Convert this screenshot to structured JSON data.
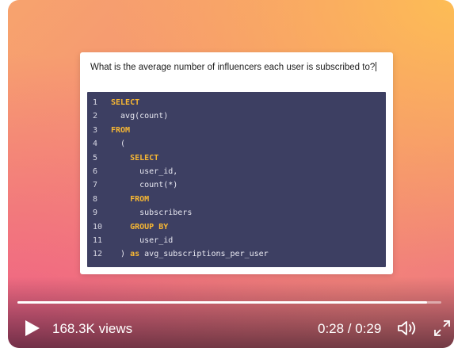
{
  "question": "What is the average number of influencers each user is subscribed to?",
  "code_lines": [
    {
      "num": "1",
      "parts": [
        {
          "t": "SELECT",
          "kw": true
        }
      ]
    },
    {
      "num": "2",
      "parts": [
        {
          "t": "  avg(count)",
          "kw": false
        }
      ]
    },
    {
      "num": "3",
      "parts": [
        {
          "t": "FROM",
          "kw": true
        }
      ]
    },
    {
      "num": "4",
      "parts": [
        {
          "t": "  (",
          "kw": false
        }
      ]
    },
    {
      "num": "5",
      "parts": [
        {
          "t": "    ",
          "kw": false
        },
        {
          "t": "SELECT",
          "kw": true
        }
      ]
    },
    {
      "num": "6",
      "parts": [
        {
          "t": "      user_id,",
          "kw": false
        }
      ]
    },
    {
      "num": "7",
      "parts": [
        {
          "t": "      count(*)",
          "kw": false
        }
      ]
    },
    {
      "num": "8",
      "parts": [
        {
          "t": "    ",
          "kw": false
        },
        {
          "t": "FROM",
          "kw": true
        }
      ]
    },
    {
      "num": "9",
      "parts": [
        {
          "t": "      subscribers",
          "kw": false
        }
      ]
    },
    {
      "num": "10",
      "parts": [
        {
          "t": "    ",
          "kw": false
        },
        {
          "t": "GROUP BY",
          "kw": true
        }
      ]
    },
    {
      "num": "11",
      "parts": [
        {
          "t": "      user_id",
          "kw": false
        }
      ]
    },
    {
      "num": "12",
      "parts": [
        {
          "t": "  ) ",
          "kw": false
        },
        {
          "t": "as",
          "kw": true
        },
        {
          "t": " avg_subscriptions_per_user",
          "kw": false
        }
      ]
    }
  ],
  "player": {
    "views": "168.3K views",
    "time": "0:28 / 0:29",
    "progress": 0.9655,
    "icons": {
      "play": "play-icon",
      "volume": "volume-icon",
      "fullscreen": "fullscreen-icon"
    }
  },
  "colors": {
    "code_bg": "#3d3f62",
    "keyword": "#f7b733",
    "code_text": "#e7e7f0"
  }
}
